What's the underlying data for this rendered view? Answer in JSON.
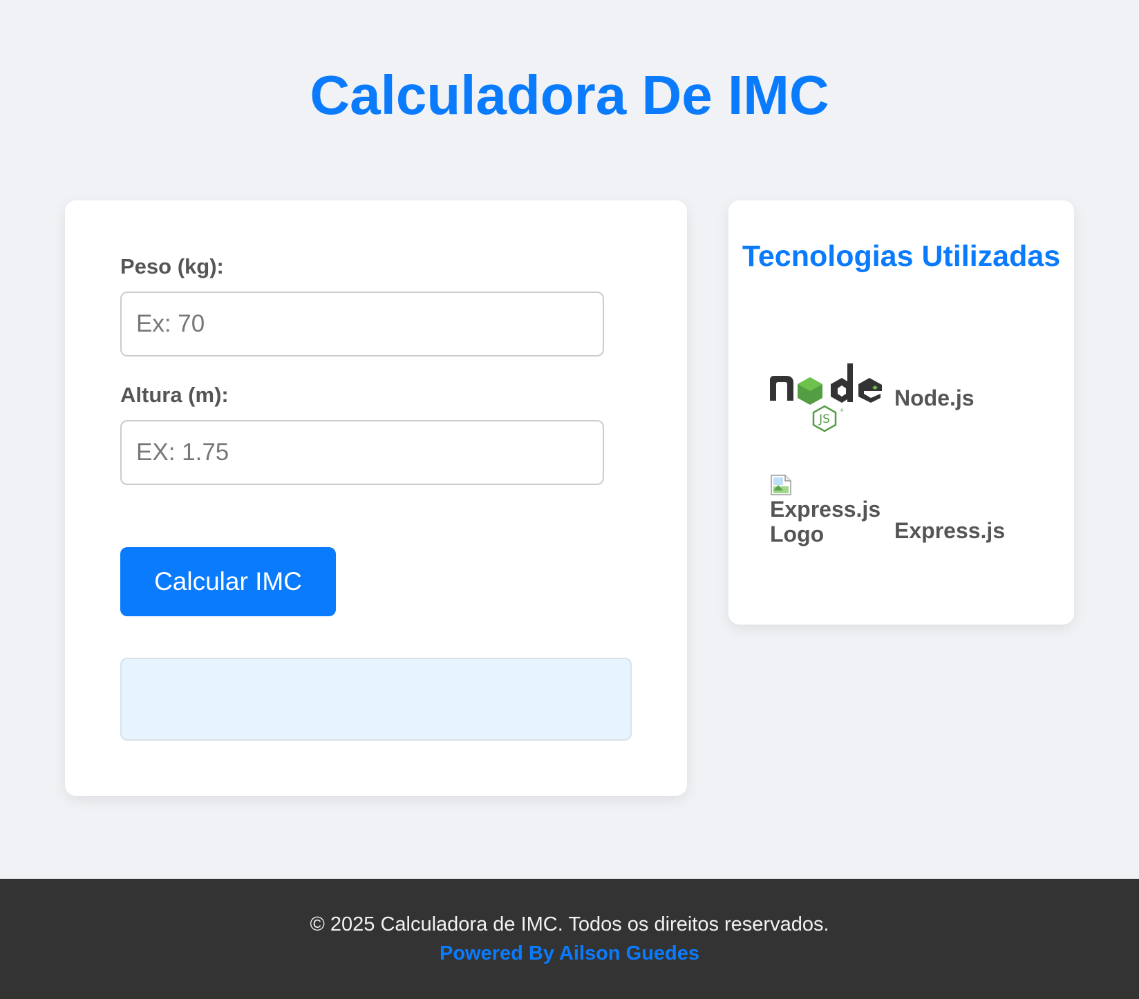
{
  "header": {
    "title": "Calculadora De IMC"
  },
  "form": {
    "weight_label": "Peso (kg):",
    "weight_placeholder": "Ex: 70",
    "weight_value": "",
    "height_label": "Altura (m):",
    "height_placeholder": "EX: 1.75",
    "height_value": "",
    "submit_label": "Calcular IMC",
    "result_text": ""
  },
  "technologies": {
    "title": "Tecnologias Utilizadas",
    "items": [
      {
        "name": "Node.js",
        "icon": "nodejs-logo-icon"
      },
      {
        "name": "Express.js",
        "icon": "broken-image-icon",
        "alt_text": "Express.js Logo"
      }
    ]
  },
  "footer": {
    "copyright": "© 2025 Calculadora de IMC. Todos os direitos reservados.",
    "credit_link": "Powered By Ailson Guedes"
  },
  "colors": {
    "accent": "#0a7bfc",
    "background": "#f0f2f5",
    "footer_bg": "#333333",
    "result_bg": "#e8f4fd"
  }
}
